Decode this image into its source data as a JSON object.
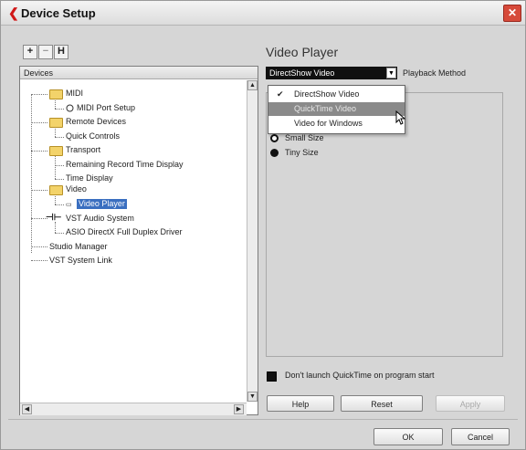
{
  "window": {
    "title": "Device Setup",
    "close_glyph": "✕"
  },
  "toolbar": {
    "add_glyph": "+",
    "remove_glyph": "−",
    "reset_glyph": "H"
  },
  "devices": {
    "header": "Devices",
    "items": [
      {
        "label": "MIDI"
      },
      {
        "label": "MIDI Port Setup"
      },
      {
        "label": "Remote Devices"
      },
      {
        "label": "Quick Controls"
      },
      {
        "label": "Transport"
      },
      {
        "label": "Remaining Record Time Display"
      },
      {
        "label": "Time Display"
      },
      {
        "label": "Video"
      },
      {
        "label": "Video Player"
      },
      {
        "label": "VST Audio System"
      },
      {
        "label": "ASIO DirectX Full Duplex Driver"
      },
      {
        "label": "Studio Manager"
      },
      {
        "label": "VST System Link"
      }
    ],
    "selected": "Video Player"
  },
  "panel": {
    "title": "Video Player",
    "method_value": "DirectShow Video",
    "method_label": "Playback Method",
    "dropdown_options": [
      "DirectShow Video",
      "QuickTime Video",
      "Video for Windows"
    ],
    "dropdown_checked": "DirectShow Video",
    "dropdown_hover": "QuickTime Video",
    "size_options": [
      "Small Size",
      "Tiny Size"
    ],
    "size_selected": "Tiny Size",
    "checkbox_label": "Don't launch QuickTime on program start",
    "buttons": {
      "help": "Help",
      "reset": "Reset",
      "apply": "Apply"
    }
  },
  "footer": {
    "ok": "OK",
    "cancel": "Cancel"
  },
  "colors": {
    "logo": "#d01818",
    "selection": "#3a6fc0",
    "hover": "#8a8a8a"
  }
}
